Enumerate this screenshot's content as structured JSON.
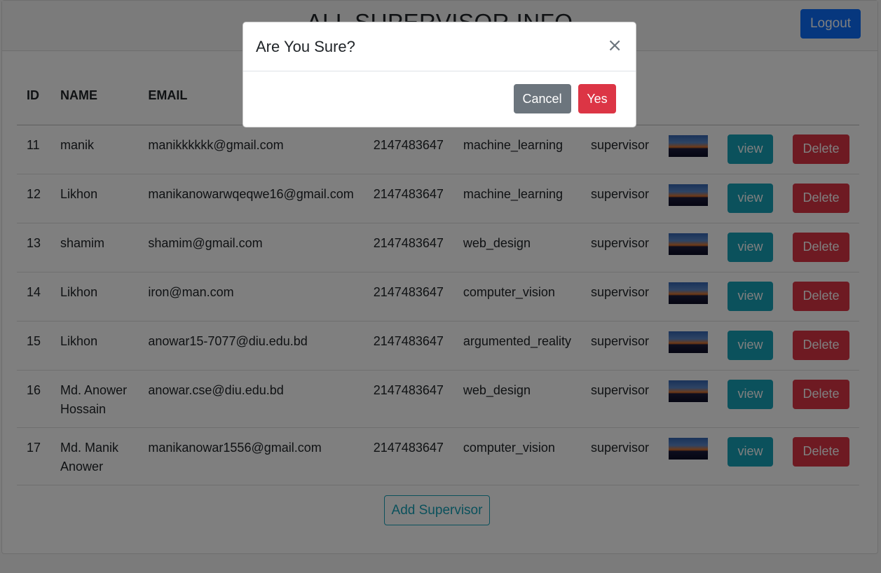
{
  "header": {
    "title": "ALL SUPERVISOR INFO",
    "logout_label": "Logout"
  },
  "table": {
    "headers": {
      "id": "ID",
      "name": "NAME",
      "email": "EMAIL"
    },
    "rows": [
      {
        "id": "11",
        "name": "manik",
        "email": "manikkkkkk@gmail.com",
        "phone": "2147483647",
        "field": "machine_learning",
        "role": "supervisor",
        "view_label": "view",
        "delete_label": "Delete"
      },
      {
        "id": "12",
        "name": "Likhon",
        "email": "manikanowarwqeqwe16@gmail.com",
        "phone": "2147483647",
        "field": "machine_learning",
        "role": "supervisor",
        "view_label": "view",
        "delete_label": "Delete"
      },
      {
        "id": "13",
        "name": "shamim",
        "email": "shamim@gmail.com",
        "phone": "2147483647",
        "field": "web_design",
        "role": "supervisor",
        "view_label": "view",
        "delete_label": "Delete"
      },
      {
        "id": "14",
        "name": "Likhon",
        "email": "iron@man.com",
        "phone": "2147483647",
        "field": "computer_vision",
        "role": "supervisor",
        "view_label": "view",
        "delete_label": "Delete"
      },
      {
        "id": "15",
        "name": "Likhon",
        "email": "anowar15-7077@diu.edu.bd",
        "phone": "2147483647",
        "field": "argumented_reality",
        "role": "supervisor",
        "view_label": "view",
        "delete_label": "Delete"
      },
      {
        "id": "16",
        "name": "Md. Anower Hossain",
        "email": "anowar.cse@diu.edu.bd",
        "phone": "2147483647",
        "field": "web_design",
        "role": "supervisor",
        "view_label": "view",
        "delete_label": "Delete"
      },
      {
        "id": "17",
        "name": "Md. Manik Anower",
        "email": "manikanowar1556@gmail.com",
        "phone": "2147483647",
        "field": "computer_vision",
        "role": "supervisor",
        "view_label": "view",
        "delete_label": "Delete"
      }
    ]
  },
  "add_button_label": "Add Supervisor",
  "modal": {
    "title": "Are You Sure?",
    "close_symbol": "×",
    "cancel_label": "Cancel",
    "yes_label": "Yes"
  },
  "colors": {
    "primary": "#0d6efd",
    "info": "#17a2b8",
    "danger": "#dc3545",
    "secondary": "#6c757d"
  },
  "icons": {
    "close": "close-icon",
    "thumbnail": "profile-image"
  }
}
